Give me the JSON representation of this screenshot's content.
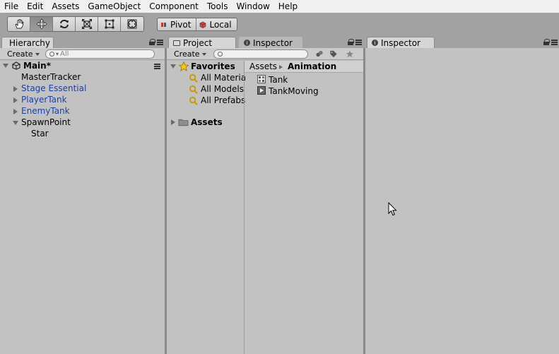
{
  "menu": [
    "File",
    "Edit",
    "Assets",
    "GameObject",
    "Component",
    "Tools",
    "Window",
    "Help"
  ],
  "toolbar": {
    "tools": [
      "hand-tool",
      "move-tool",
      "rotate-tool",
      "scale-tool",
      "rect-tool",
      "transform-tool"
    ],
    "active_tool": "move-tool",
    "pivot_label": "Pivot",
    "local_label": "Local"
  },
  "hierarchy": {
    "tab_label": "Hierarchy",
    "create_label": "Create",
    "search_placeholder": "All",
    "scene_name": "Main*",
    "items": [
      {
        "label": "MasterTracker",
        "indent": 1,
        "expander": "none",
        "prefab": false
      },
      {
        "label": "Stage Essential",
        "indent": 1,
        "expander": "collapsed",
        "prefab": true
      },
      {
        "label": "PlayerTank",
        "indent": 1,
        "expander": "collapsed",
        "prefab": true
      },
      {
        "label": "EnemyTank",
        "indent": 1,
        "expander": "collapsed",
        "prefab": true
      },
      {
        "label": "SpawnPoint",
        "indent": 1,
        "expander": "expanded",
        "prefab": false
      },
      {
        "label": "Star",
        "indent": 2,
        "expander": "none",
        "prefab": false
      }
    ]
  },
  "project": {
    "tab_label": "Project",
    "inspector_tab_label": "Inspector",
    "create_label": "Create",
    "favorites_label": "Favorites",
    "favorites": [
      "All Materia",
      "All Models",
      "All Prefabs"
    ],
    "assets_label": "Assets",
    "breadcrumb": [
      "Assets",
      "Animation"
    ],
    "files": [
      {
        "label": "Tank",
        "icon": "animator-controller-icon"
      },
      {
        "label": "TankMoving",
        "icon": "animation-clip-icon"
      }
    ]
  },
  "inspector": {
    "tab_label": "Inspector"
  },
  "colors": {
    "prefab_text": "#1f3fa5",
    "panel_bg": "#c2c2c2",
    "chrome_bg": "#a2a2a2"
  }
}
